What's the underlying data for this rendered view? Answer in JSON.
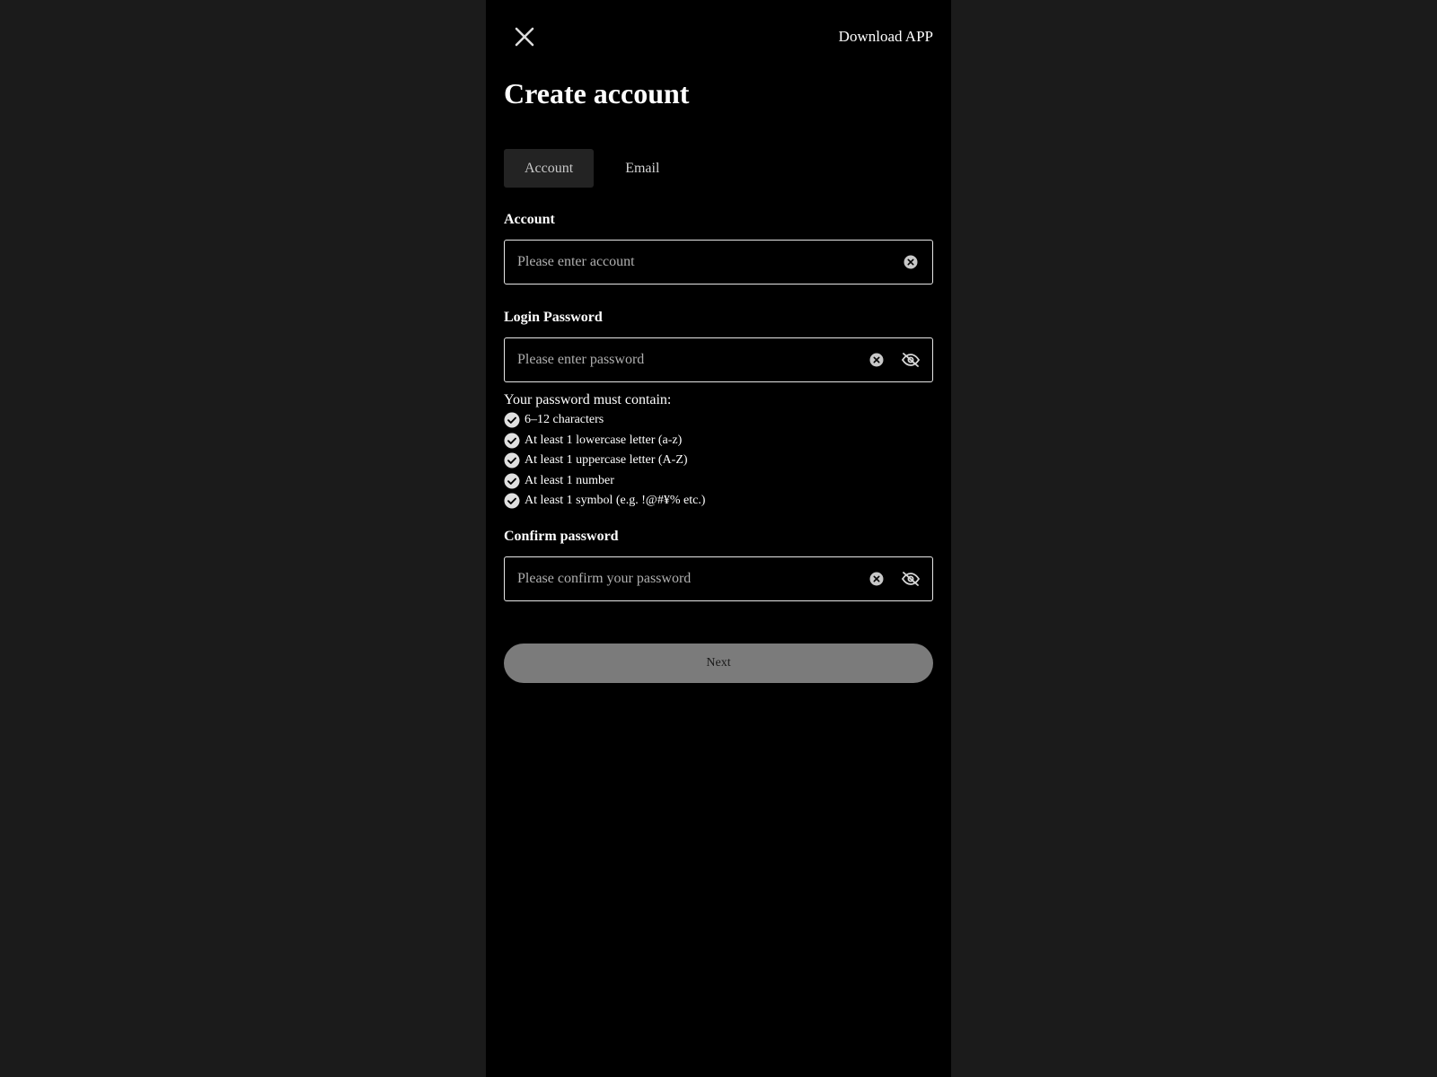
{
  "header": {
    "close_icon": "close-icon",
    "download_label": "Download APP"
  },
  "title": "Create account",
  "tabs": [
    {
      "label": "Account",
      "active": true
    },
    {
      "label": "Email",
      "active": false
    }
  ],
  "account_field": {
    "label": "Account",
    "placeholder": "Please enter account",
    "value": ""
  },
  "password_field": {
    "label": "Login Password",
    "placeholder": "Please enter password",
    "value": ""
  },
  "password_rules": {
    "title": "Your password must contain:",
    "items": [
      "6–12 characters",
      "At least 1 lowercase letter (a-z)",
      "At least 1 uppercase letter (A-Z)",
      "At least 1 number",
      "At least 1 symbol (e.g. !@#¥% etc.)"
    ]
  },
  "confirm_field": {
    "label": "Confirm password",
    "placeholder": "Please confirm your password",
    "value": ""
  },
  "next_label": "Next",
  "colors": {
    "page_bg": "#1b1b1b",
    "panel_bg": "#000000",
    "active_tab_bg": "#232323",
    "button_bg": "#7b7b7b"
  }
}
